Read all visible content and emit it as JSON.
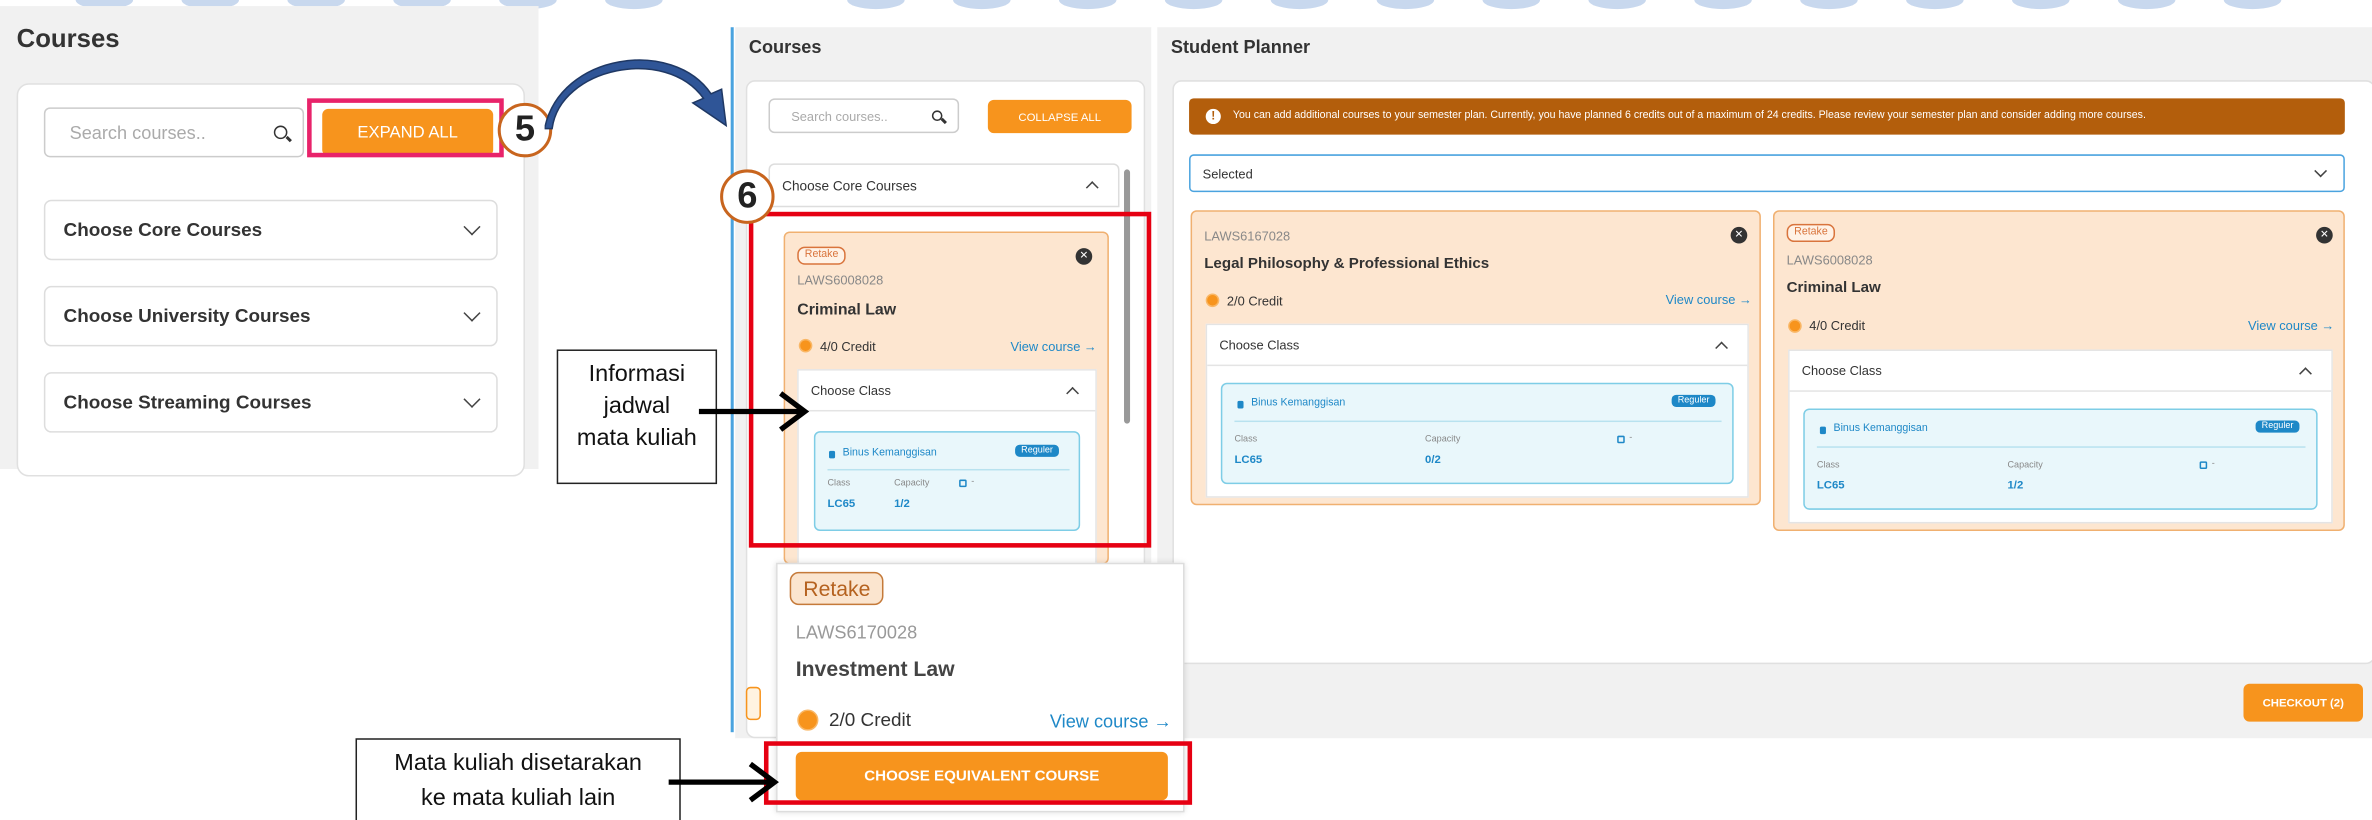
{
  "left": {
    "title": "Courses",
    "search_placeholder": "Search courses..",
    "expand_btn": "EXPAND ALL",
    "accordions": [
      "Choose Core Courses",
      "Choose University Courses",
      "Choose Streaming Courses"
    ]
  },
  "step5": "5",
  "step6": "6",
  "mid": {
    "title": "Courses",
    "search_placeholder": "Search courses..",
    "collapse_btn": "COLLAPSE ALL",
    "core_label": "Choose Core Courses",
    "course": {
      "badge": "Retake",
      "code": "LAWS6008028",
      "name": "Criminal Law",
      "credit": "4/0 Credit",
      "view": "View course →",
      "choose_class": "Choose Class",
      "campus": "Binus Kemanggisan",
      "tag": "Reguler",
      "class_label": "Class",
      "class_value": "LC65",
      "capacity_label": "Capacity",
      "capacity_value": "1/2",
      "extra": "-"
    }
  },
  "planner": {
    "title": "Student Planner",
    "alert": "You can add additional courses to your semester plan. Currently, you have planned 6 credits out of a maximum of 24 credits. Please review your semester plan and consider adding more courses.",
    "select_value": "Selected",
    "cards": [
      {
        "badge": "",
        "code": "LAWS6167028",
        "name": "Legal Philosophy & Professional Ethics",
        "credit": "2/0 Credit",
        "view": "View course →",
        "choose_class": "Choose Class",
        "campus": "Binus Kemanggisan",
        "tag": "Reguler",
        "class_label": "Class",
        "class_value": "LC65",
        "capacity_label": "Capacity",
        "capacity_value": "0/2",
        "extra": "-"
      },
      {
        "badge": "Retake",
        "code": "LAWS6008028",
        "name": "Criminal Law",
        "credit": "4/0 Credit",
        "view": "View course →",
        "choose_class": "Choose Class",
        "campus": "Binus Kemanggisan",
        "tag": "Reguler",
        "class_label": "Class",
        "class_value": "LC65",
        "capacity_label": "Capacity",
        "capacity_value": "1/2",
        "extra": "-"
      }
    ],
    "checkout": "CHECKOUT (2)"
  },
  "popup": {
    "badge": "Retake",
    "code": "LAWS6170028",
    "name": "Investment Law",
    "credit": "2/0 Credit",
    "view": "View course →",
    "equiv_btn": "CHOOSE EQUIVALENT COURSE"
  },
  "annotations": {
    "info_lines": [
      "Informasi",
      "jadwal",
      "mata kuliah"
    ],
    "equiv_lines": [
      "Mata kuliah disetarakan",
      "ke mata kuliah lain"
    ]
  },
  "colors": {
    "accent": "#f7941d",
    "alert": "#b35e0c",
    "highlight": "#e60012",
    "link": "#1e88c7"
  }
}
